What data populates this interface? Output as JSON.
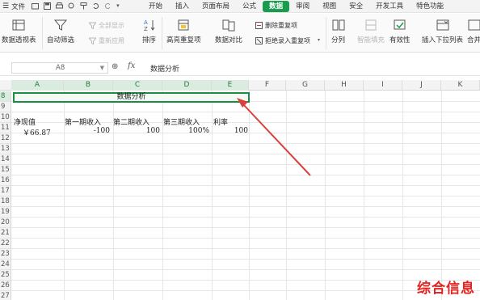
{
  "menubar": {
    "file_label": "文件",
    "tabs": [
      {
        "label": "开始",
        "active": false
      },
      {
        "label": "插入",
        "active": false
      },
      {
        "label": "页面布局",
        "active": false
      },
      {
        "label": "公式",
        "active": false
      },
      {
        "label": "数据",
        "active": true
      },
      {
        "label": "审阅",
        "active": false
      },
      {
        "label": "视图",
        "active": false
      },
      {
        "label": "安全",
        "active": false
      },
      {
        "label": "开发工具",
        "active": false
      },
      {
        "label": "特色功能",
        "active": false
      }
    ]
  },
  "ribbon": {
    "pivot": "数据透视表",
    "autofilter": "自动筛选",
    "show_all": "全部显示",
    "reapply": "重新应用",
    "sort": "排序",
    "highlight_dup": "高亮重复项",
    "data_compare": "数据对比",
    "remove_dup": "删除重复项",
    "reject_dup": "拒绝录入重复项",
    "split": "分列",
    "fill": "智能填充",
    "validity": "有效性",
    "dropdown": "插入下拉列表",
    "consolidate": "合并"
  },
  "formula_bar": {
    "cell_ref": "A8",
    "content": "数据分析"
  },
  "columns": [
    "A",
    "B",
    "C",
    "D",
    "E",
    "F",
    "G",
    "H",
    "I",
    "J",
    "K"
  ],
  "selected_columns": [
    "A",
    "B",
    "C",
    "D",
    "E"
  ],
  "rows": [
    "8",
    "9",
    "10",
    "11",
    "12",
    "13",
    "14",
    "15",
    "16",
    "17",
    "18",
    "19",
    "20",
    "21",
    "22",
    "23",
    "24",
    "25",
    "26",
    "27"
  ],
  "sheet": {
    "merged_title": "数据分析",
    "headers": [
      "净现值",
      "第一期收入",
      "第二期收入",
      "第三期收入",
      "利率"
    ],
    "values": [
      "￥66.87",
      "-100",
      "100",
      "100%",
      "100"
    ]
  },
  "colors": {
    "accent": "#1a9c4e",
    "arrow": "#d9403a",
    "watermark": "#e3231f"
  },
  "watermark": "综合信息"
}
